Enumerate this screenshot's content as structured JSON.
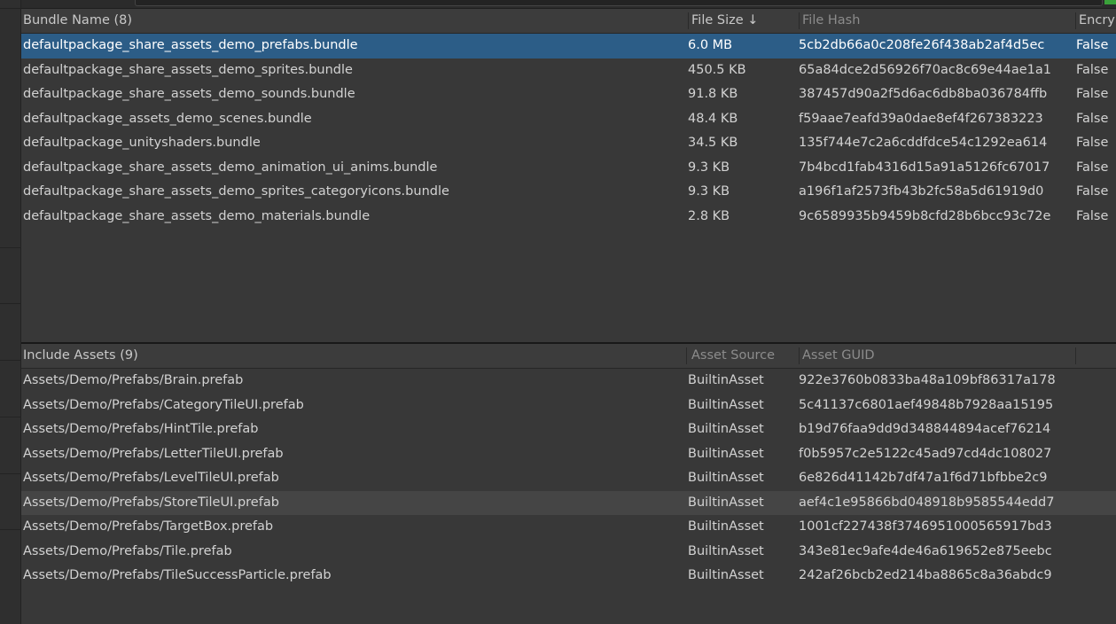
{
  "bundles": {
    "columns": {
      "name": "Bundle Name (8)",
      "size": "File Size",
      "size_sort_icon": "↓",
      "hash": "File Hash",
      "encrypted": "Encry"
    },
    "selected_index": 0,
    "rows": [
      {
        "name": "defaultpackage_share_assets_demo_prefabs.bundle",
        "size": "6.0 MB",
        "hash": "5cb2db66a0c208fe26f438ab2af4d5ec",
        "encrypted": "False"
      },
      {
        "name": "defaultpackage_share_assets_demo_sprites.bundle",
        "size": "450.5 KB",
        "hash": "65a84dce2d56926f70ac8c69e44ae1a1",
        "encrypted": "False"
      },
      {
        "name": "defaultpackage_share_assets_demo_sounds.bundle",
        "size": "91.8 KB",
        "hash": "387457d90a2f5d6ac6db8ba036784ffb",
        "encrypted": "False"
      },
      {
        "name": "defaultpackage_assets_demo_scenes.bundle",
        "size": "48.4 KB",
        "hash": "f59aae7eafd39a0dae8ef4f267383223",
        "encrypted": "False"
      },
      {
        "name": "defaultpackage_unityshaders.bundle",
        "size": "34.5 KB",
        "hash": "135f744e7c2a6cddfdce54c1292ea614",
        "encrypted": "False"
      },
      {
        "name": "defaultpackage_share_assets_demo_animation_ui_anims.bundle",
        "size": "9.3 KB",
        "hash": "7b4bcd1fab4316d15a91a5126fc67017",
        "encrypted": "False"
      },
      {
        "name": "defaultpackage_share_assets_demo_sprites_categoryicons.bundle",
        "size": "9.3 KB",
        "hash": "a196f1af2573fb43b2fc58a5d61919d0",
        "encrypted": "False"
      },
      {
        "name": "defaultpackage_share_assets_demo_materials.bundle",
        "size": "2.8 KB",
        "hash": "9c6589935b9459b8cfd28b6bcc93c72e",
        "encrypted": "False"
      }
    ]
  },
  "assets": {
    "columns": {
      "path": "Include Assets (9)",
      "source": "Asset Source",
      "guid": "Asset GUID"
    },
    "hover_index": 5,
    "rows": [
      {
        "path": "Assets/Demo/Prefabs/Brain.prefab",
        "source": "BuiltinAsset",
        "guid": "922e3760b0833ba48a109bf86317a178"
      },
      {
        "path": "Assets/Demo/Prefabs/CategoryTileUI.prefab",
        "source": "BuiltinAsset",
        "guid": "5c41137c6801aef49848b7928aa15195"
      },
      {
        "path": "Assets/Demo/Prefabs/HintTile.prefab",
        "source": "BuiltinAsset",
        "guid": "b19d76faa9dd9d348844894acef76214"
      },
      {
        "path": "Assets/Demo/Prefabs/LetterTileUI.prefab",
        "source": "BuiltinAsset",
        "guid": "f0b5957c2e5122c45ad97cd4dc108027"
      },
      {
        "path": "Assets/Demo/Prefabs/LevelTileUI.prefab",
        "source": "BuiltinAsset",
        "guid": "6e826d41142b7df47a1f6d71bfbbe2c9"
      },
      {
        "path": "Assets/Demo/Prefabs/StoreTileUI.prefab",
        "source": "BuiltinAsset",
        "guid": "aef4c1e95866bd048918b9585544edd7"
      },
      {
        "path": "Assets/Demo/Prefabs/TargetBox.prefab",
        "source": "BuiltinAsset",
        "guid": "1001cf227438f3746951000565917bd3"
      },
      {
        "path": "Assets/Demo/Prefabs/Tile.prefab",
        "source": "BuiltinAsset",
        "guid": "343e81ec9afe4de46a619652e875eebc"
      },
      {
        "path": "Assets/Demo/Prefabs/TileSuccessParticle.prefab",
        "source": "BuiltinAsset",
        "guid": "242af26bcb2ed214ba8865c8a36abdc9"
      }
    ]
  }
}
